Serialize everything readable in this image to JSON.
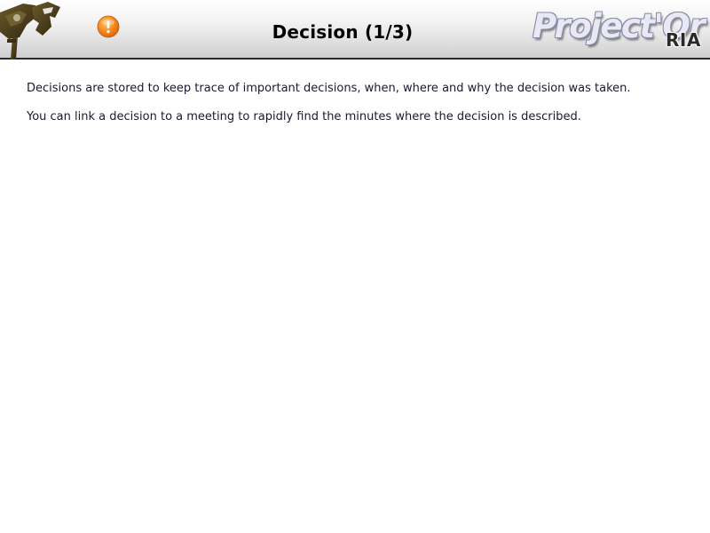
{
  "header": {
    "title": "Decision (1/3)",
    "brand_name": "Project'Or",
    "brand_suffix": "RIA",
    "alert_icon": "warning-icon",
    "logo_icon": "projector-logo-icon"
  },
  "content": {
    "paragraphs": [
      "Decisions are stored to keep trace of important decisions, when, where and why the decision was taken.",
      "You can link a decision to a meeting to rapidly find the minutes where the decision is described."
    ]
  },
  "colors": {
    "header_gradient_top": "#ffffff",
    "header_gradient_bottom": "#cfcfcf",
    "header_border": "#2a2a2a",
    "alert_orange": "#f07a10",
    "logo_olive": "#4a3c1a",
    "text": "#1a1a2e"
  }
}
